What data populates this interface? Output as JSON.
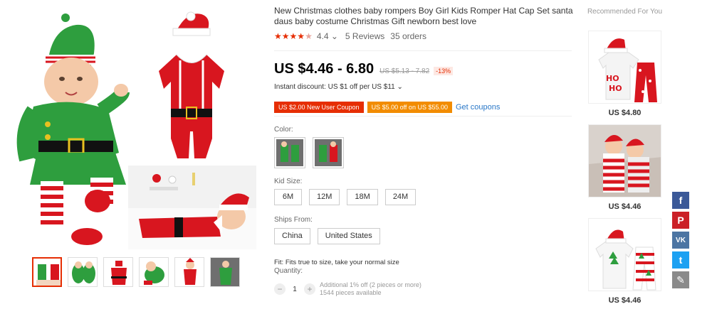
{
  "product": {
    "title": "New Christmas clothes baby rompers Boy Girl Kids Romper Hat Cap Set santa daus baby costume Christmas Gift newborn best love",
    "rating_value": "4.4",
    "rating_chevron": "⌄",
    "reviews": "5 Reviews",
    "orders": "35 orders",
    "price": "US $4.46 - 6.80",
    "old_price": "US $5.13 - 7.82",
    "discount": "-13%",
    "instant_discount": "Instant discount: US $1 off per US $11 ⌄",
    "coupons": [
      "US $2.00 New User Coupon",
      "US $5.00 off on US $55.00"
    ],
    "get_coupons": "Get coupons",
    "color_label": "Color:",
    "size_label": "Kid Size:",
    "sizes": [
      "6M",
      "12M",
      "18M",
      "24M"
    ],
    "ships_label": "Ships From:",
    "ships": [
      "China",
      "United States"
    ],
    "fit": "Fit: Fits true to size, take your normal size",
    "quantity_label": "Quantity:",
    "quantity": "1",
    "qty_minus": "−",
    "qty_plus": "+",
    "qty_note_1": "Additional 1% off (2 pieces or more)",
    "qty_note_2": "1544 pieces available"
  },
  "recommended": {
    "title": "Recommended For You",
    "items": [
      {
        "price": "US $4.80"
      },
      {
        "price": "US $4.46"
      },
      {
        "price": "US $4.46"
      }
    ]
  },
  "share": {
    "facebook": "f",
    "pinterest": "P",
    "vk": "VK",
    "twitter": "t",
    "edit": "✎"
  },
  "colors": {
    "accent": "#e62e04",
    "coupon_orange": "#f28c00",
    "link": "#2a78c8",
    "elf_green": "#2e9e3e",
    "santa_red": "#d8161f"
  }
}
